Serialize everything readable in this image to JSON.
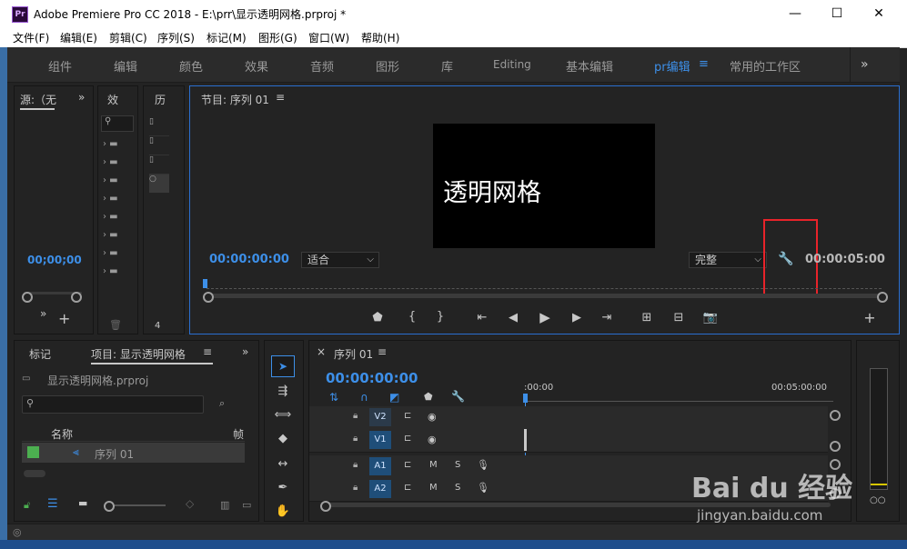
{
  "window": {
    "title": "Adobe Premiere Pro CC 2018 - E:\\prr\\显示透明网格.prproj *",
    "app_icon": "Pr",
    "minimize": "—",
    "maximize": "☐",
    "close": "✕"
  },
  "menu": [
    "文件(F)",
    "编辑(E)",
    "剪辑(C)",
    "序列(S)",
    "标记(M)",
    "图形(G)",
    "窗口(W)",
    "帮助(H)"
  ],
  "workspaces": [
    "组件",
    "编辑",
    "颜色",
    "效果",
    "音频",
    "图形",
    "库",
    "Editing",
    "基本编辑",
    "pr编辑",
    "常用的工作区"
  ],
  "workspace_active": "pr编辑",
  "workspace_menu_icon": "≡",
  "workspace_more": "»",
  "source_panel": {
    "tab": "源:（无",
    "more": "»",
    "timecode": "00;00;00",
    "add": "+",
    "more2": "»"
  },
  "effects_panel": {
    "tab": "效"
  },
  "history_panel": {
    "tab": "历",
    "footer": "4"
  },
  "program_monitor": {
    "tab": "节目: 序列 01",
    "menu_icon": "≡",
    "overlay_text": "透明网格",
    "timecode_left": "00:00:00:00",
    "fit": "适合",
    "quality": "完整",
    "timecode_right": "00:00:05:00",
    "add": "+"
  },
  "bottom_left": {
    "tab_markers": "标记",
    "tab_project": "项目: 显示透明网格",
    "menu_icon": "≡",
    "more": "»",
    "project_file": "显示透明网格.prproj",
    "search_placeholder": "",
    "col_name": "名称",
    "col_frame": "帧",
    "item_name": "序列 01"
  },
  "timeline": {
    "close": "×",
    "tab": "序列 01",
    "menu_icon": "≡",
    "timecode": "00:00:00:00",
    "ruler_start": ":00:00",
    "ruler_end": "00:05:00:00",
    "tracks": [
      {
        "name": "V2",
        "m": "",
        "s": ""
      },
      {
        "name": "V1",
        "m": "",
        "s": ""
      },
      {
        "name": "A1",
        "m": "M",
        "s": "S"
      },
      {
        "name": "A2",
        "m": "M",
        "s": "S"
      }
    ]
  },
  "audio_meter": {
    "label": "○○"
  },
  "colors": {
    "accent": "#3d8fe8",
    "highlight": "#e8232a",
    "track_blue": "#1f4e79"
  },
  "watermark": {
    "brand": "Bai du 经验",
    "url": "jingyan.baidu.com"
  }
}
